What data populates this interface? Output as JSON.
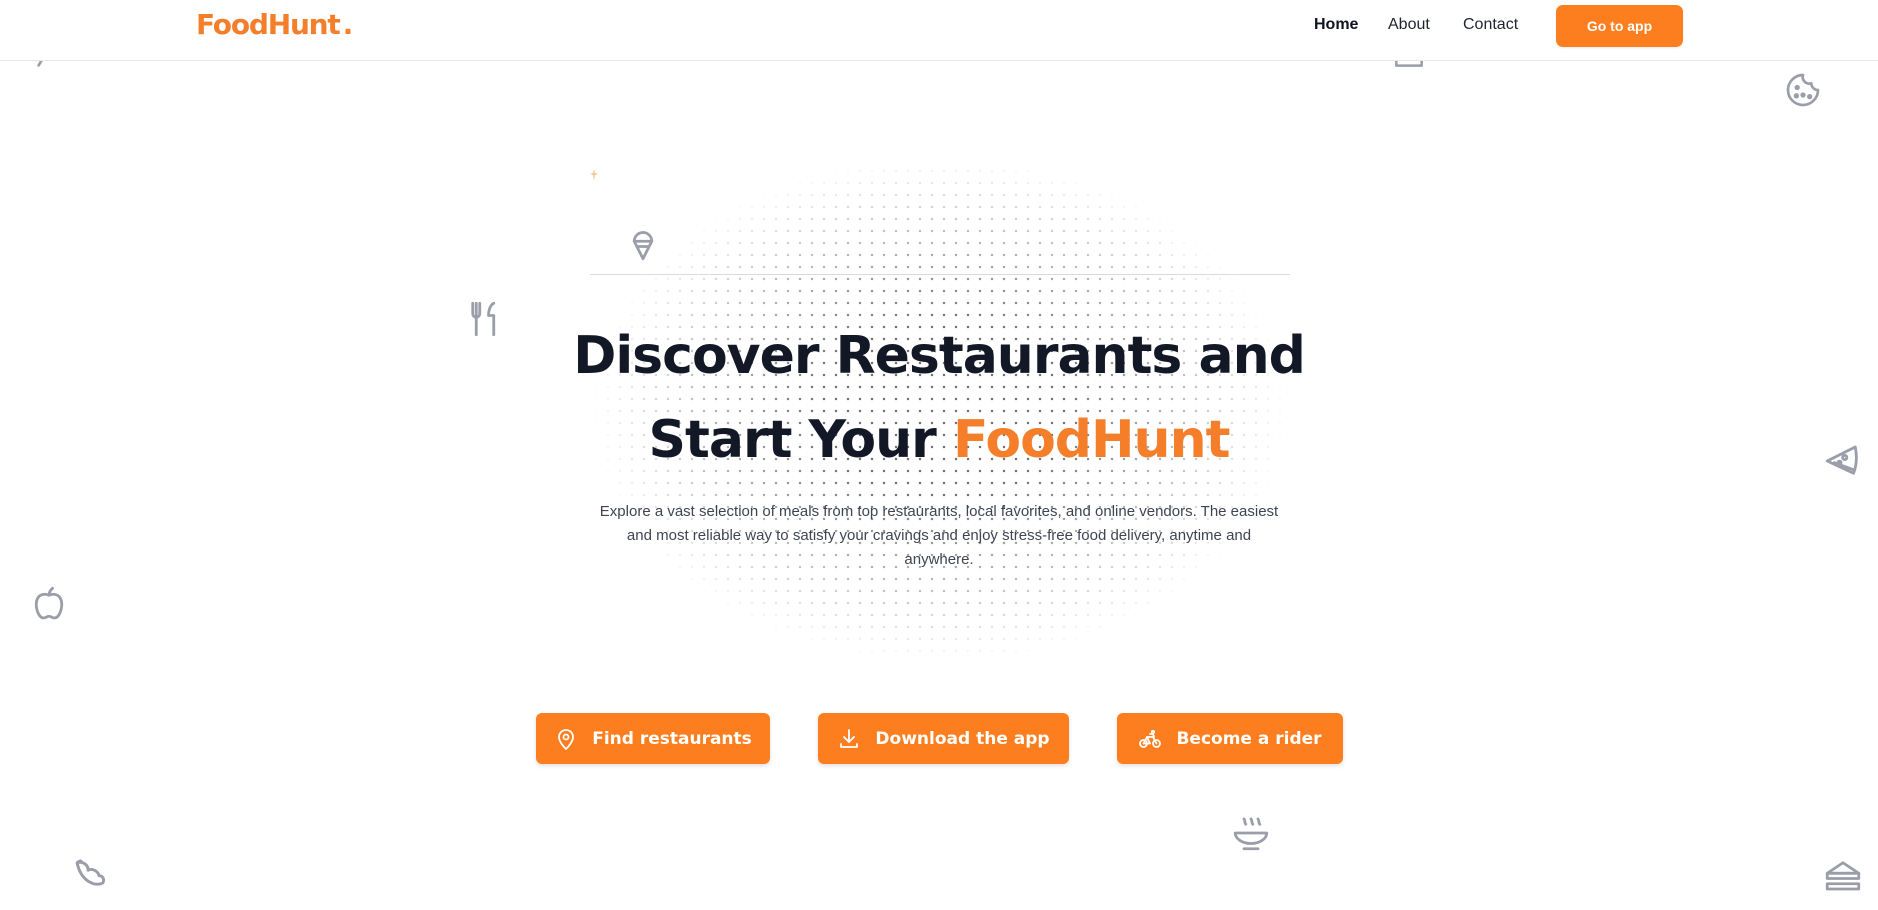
{
  "header": {
    "logo_text": "FoodHunt",
    "logo_dot": ".",
    "nav": {
      "home": "Home",
      "about": "About",
      "contact": "Contact"
    },
    "cta_label": "Go to app"
  },
  "hero": {
    "title_line1": "Discover Restaurants and",
    "title_line2_prefix": "Start Your ",
    "title_line2_brand": "FoodHunt",
    "description": "Explore a vast selection of meals from top restaurants, local favorites, and online vendors. The easiest and most reliable way to satisfy your cravings and enjoy stress-free food delivery, anytime and anywhere."
  },
  "actions": {
    "find_restaurants": "Find restaurants",
    "download_app": "Download the app",
    "become_rider": "Become a rider"
  },
  "icons": {
    "find_restaurants": "map-pin-icon",
    "download_app": "download-icon",
    "become_rider": "bicycle-icon",
    "decor": [
      "candy-icon",
      "cake-slice-icon",
      "cookie-icon",
      "ice-cream-icon",
      "utensils-icon",
      "pizza-slice-icon",
      "apple-icon",
      "croissant-icon",
      "soup-bowl-icon",
      "sandwich-icon"
    ]
  },
  "colors": {
    "brand_orange": "#fd7e1e",
    "logo_orange": "#f47e2a",
    "heading": "#121826",
    "body_text": "#3f4452",
    "decor_gray": "#9a9ea8"
  }
}
